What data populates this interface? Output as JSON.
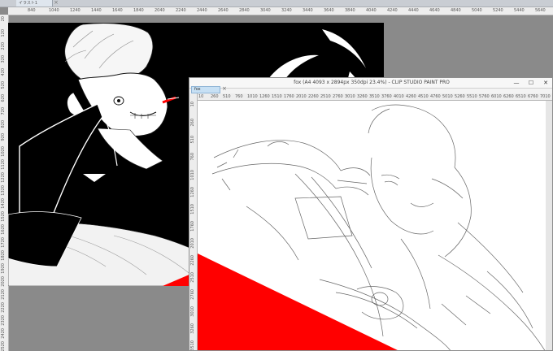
{
  "back_window": {
    "tab_label": "イラスト1",
    "tab_close_icon": "×",
    "ruler_top": [
      "840",
      "1040",
      "1240",
      "1440",
      "1640",
      "1840",
      "2040",
      "2240",
      "2440",
      "2640",
      "2840",
      "3040",
      "3240",
      "3440",
      "3640",
      "3840",
      "4040",
      "4240",
      "4440",
      "4640",
      "4840",
      "5040",
      "5240",
      "5440",
      "5640",
      "5840"
    ],
    "ruler_left": [
      "20",
      "120",
      "220",
      "320",
      "420",
      "520",
      "620",
      "720",
      "820",
      "920",
      "1020",
      "1120",
      "1220",
      "1320",
      "1420",
      "1520",
      "1620",
      "1720",
      "1820",
      "1920",
      "2020",
      "2120",
      "2220",
      "2320",
      "2420",
      "2520"
    ]
  },
  "front_window": {
    "title": "fox (A4 4093 x 2894px 350dpi 23.4%) - CLIP STUDIO PAINT PRO",
    "tab_label": "fox",
    "tab_close_icon": "×",
    "minimize_icon": "—",
    "maximize_icon": "☐",
    "close_icon": "✕",
    "ruler_top": [
      "10",
      "260",
      "510",
      "760",
      "1010",
      "1260",
      "1510",
      "1760",
      "2010",
      "2260",
      "2510",
      "2760",
      "3010",
      "3260",
      "3510",
      "3760",
      "4010",
      "4260",
      "4510",
      "4760",
      "5010",
      "5260",
      "5510",
      "5760",
      "6010",
      "6260",
      "6510",
      "6760",
      "7010",
      "7260"
    ],
    "ruler_left": [
      "10",
      "260",
      "510",
      "760",
      "1010",
      "1260",
      "1510",
      "1760",
      "2010",
      "2260",
      "2510",
      "2760",
      "3010",
      "3260",
      "3510"
    ]
  },
  "colors": {
    "accent_red": "#ff0000",
    "canvas_black": "#000000",
    "workspace_gray": "#8a8a8a"
  }
}
